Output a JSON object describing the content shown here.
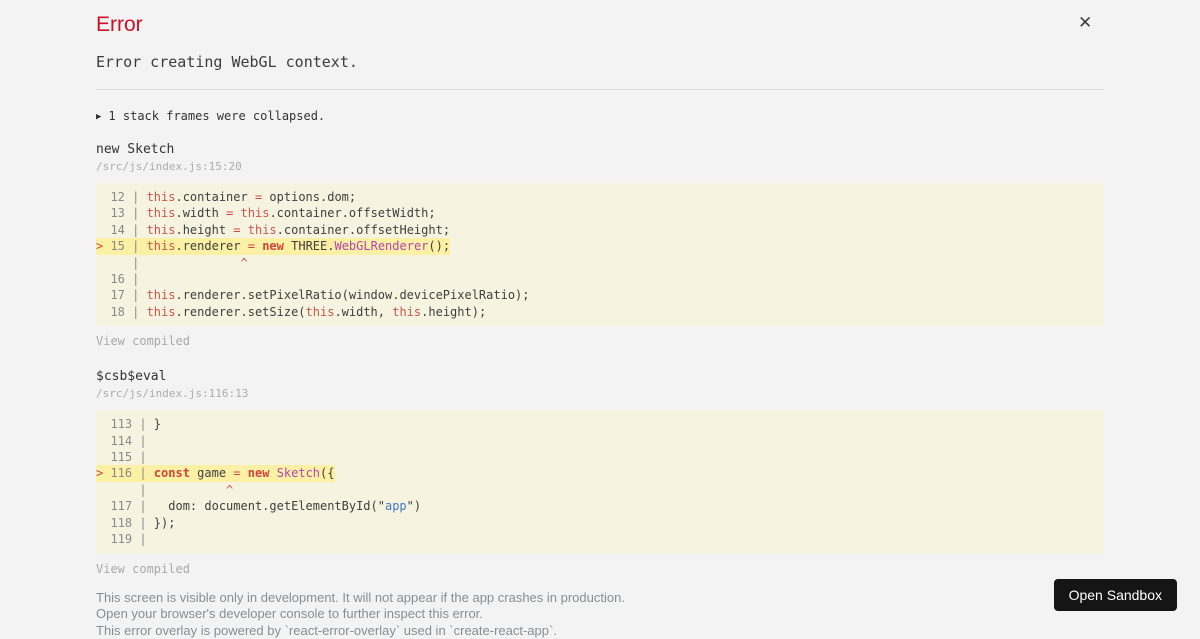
{
  "colors": {
    "page_background": "#f3f3f3",
    "title_red": "#ce1126",
    "code_block_background": "#f6f3e1",
    "highlight_line_yellow": "#fbf0a3",
    "keyword_red": "#c9584d",
    "class_magenta": "#b545b2",
    "string_blue": "#4078c0",
    "footer_gray": "#878e91",
    "sandbox_button_background": "#151515"
  },
  "header": {
    "title": "Error",
    "message": "Error creating WebGL context.",
    "close_icon": "✕"
  },
  "collapsed": {
    "icon": "▶",
    "label": "1 stack frames were collapsed."
  },
  "frames": [
    {
      "fn": "new Sketch",
      "location": "/src/js/index.js:15:20",
      "view_compiled": "View compiled",
      "lines": [
        {
          "hl": false,
          "t": [
            [
              "g",
              "  12 | "
            ],
            [
              "k",
              "this"
            ],
            [
              "d",
              ".container "
            ],
            [
              "o",
              "="
            ],
            [
              "d",
              " options.dom;"
            ]
          ]
        },
        {
          "hl": false,
          "t": [
            [
              "g",
              "  13 | "
            ],
            [
              "k",
              "this"
            ],
            [
              "d",
              ".width "
            ],
            [
              "o",
              "="
            ],
            [
              "d",
              " "
            ],
            [
              "k",
              "this"
            ],
            [
              "d",
              ".container.offsetWidth;"
            ]
          ]
        },
        {
          "hl": false,
          "t": [
            [
              "g",
              "  14 | "
            ],
            [
              "k",
              "this"
            ],
            [
              "d",
              ".height "
            ],
            [
              "o",
              "="
            ],
            [
              "d",
              " "
            ],
            [
              "k",
              "this"
            ],
            [
              "d",
              ".container.offsetHeight;"
            ]
          ]
        },
        {
          "hl": true,
          "t": [
            [
              "m",
              "> "
            ],
            [
              "g",
              "15 | "
            ],
            [
              "k",
              "this"
            ],
            [
              "d",
              ".renderer "
            ],
            [
              "o",
              "="
            ],
            [
              "d",
              " "
            ],
            [
              "n",
              "new"
            ],
            [
              "d",
              " THREE."
            ],
            [
              "c",
              "WebGLRenderer"
            ],
            [
              "d",
              "();"
            ]
          ]
        },
        {
          "hl": false,
          "t": [
            [
              "g",
              "     | "
            ],
            [
              "x",
              "             ^"
            ]
          ]
        },
        {
          "hl": false,
          "t": [
            [
              "g",
              "  16 |"
            ]
          ]
        },
        {
          "hl": false,
          "t": [
            [
              "g",
              "  17 | "
            ],
            [
              "k",
              "this"
            ],
            [
              "d",
              ".renderer.setPixelRatio(window.devicePixelRatio);"
            ]
          ]
        },
        {
          "hl": false,
          "t": [
            [
              "g",
              "  18 | "
            ],
            [
              "k",
              "this"
            ],
            [
              "d",
              ".renderer.setSize("
            ],
            [
              "k",
              "this"
            ],
            [
              "d",
              ".width, "
            ],
            [
              "k",
              "this"
            ],
            [
              "d",
              ".height);"
            ]
          ]
        }
      ]
    },
    {
      "fn": "$csb$eval",
      "location": "/src/js/index.js:116:13",
      "view_compiled": "View compiled",
      "lines": [
        {
          "hl": false,
          "t": [
            [
              "g",
              "  113 | "
            ],
            [
              "d",
              "}"
            ]
          ]
        },
        {
          "hl": false,
          "t": [
            [
              "g",
              "  114 |"
            ]
          ]
        },
        {
          "hl": false,
          "t": [
            [
              "g",
              "  115 |"
            ]
          ]
        },
        {
          "hl": true,
          "t": [
            [
              "m",
              "> "
            ],
            [
              "g",
              "116 | "
            ],
            [
              "n",
              "const"
            ],
            [
              "d",
              " game "
            ],
            [
              "o",
              "="
            ],
            [
              "d",
              " "
            ],
            [
              "n",
              "new"
            ],
            [
              "d",
              " "
            ],
            [
              "c",
              "Sketch"
            ],
            [
              "d",
              "({"
            ]
          ]
        },
        {
          "hl": false,
          "t": [
            [
              "g",
              "      | "
            ],
            [
              "x",
              "          ^"
            ]
          ]
        },
        {
          "hl": false,
          "t": [
            [
              "g",
              "  117 | "
            ],
            [
              "d",
              "  dom: document.getElementById(\""
            ],
            [
              "s",
              "app"
            ],
            [
              "d",
              "\")"
            ]
          ]
        },
        {
          "hl": false,
          "t": [
            [
              "g",
              "  118 | "
            ],
            [
              "d",
              "});"
            ]
          ]
        },
        {
          "hl": false,
          "t": [
            [
              "g",
              "  119 |"
            ]
          ]
        }
      ]
    }
  ],
  "footer": {
    "lines": [
      "This screen is visible only in development. It will not appear if the app crashes in production.",
      "Open your browser's developer console to further inspect this error.",
      "This error overlay is powered by `react-error-overlay` used in `create-react-app`."
    ]
  },
  "sandbox_button": {
    "label": "Open Sandbox"
  }
}
